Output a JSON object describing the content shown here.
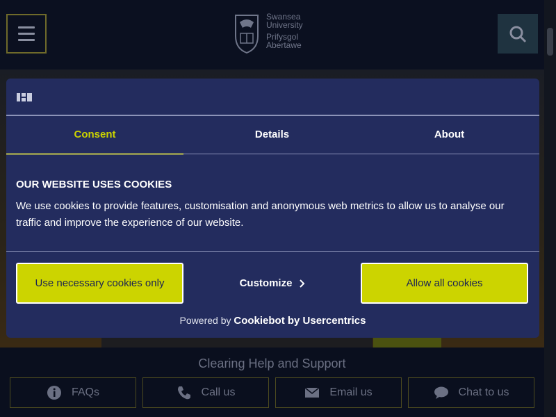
{
  "header": {
    "logo_lines": [
      "Swansea",
      "University",
      "Prifysgol",
      "Abertawe"
    ]
  },
  "cookie_dialog": {
    "tabs": [
      {
        "label": "Consent",
        "active": true
      },
      {
        "label": "Details",
        "active": false
      },
      {
        "label": "About",
        "active": false
      }
    ],
    "heading": "OUR WEBSITE USES COOKIES",
    "body": "We use cookies to provide features, customisation and anonymous web metrics to allow us to analyse our traffic and improve the experience of our website.",
    "buttons": {
      "necessary": "Use necessary cookies only",
      "customize": "Customize",
      "allow_all": "Allow all cookies"
    },
    "powered_prefix": "Powered by",
    "powered_brand": "Cookiebot by Usercentrics",
    "colors": {
      "background": "#232c5e",
      "accent": "#ccd400"
    }
  },
  "help": {
    "title": "Clearing Help and Support",
    "links": [
      {
        "label": "FAQs",
        "icon": "info-icon"
      },
      {
        "label": "Call us",
        "icon": "phone-icon"
      },
      {
        "label": "Email us",
        "icon": "envelope-icon"
      },
      {
        "label": "Chat to us",
        "icon": "chat-bubble-icon"
      }
    ]
  }
}
